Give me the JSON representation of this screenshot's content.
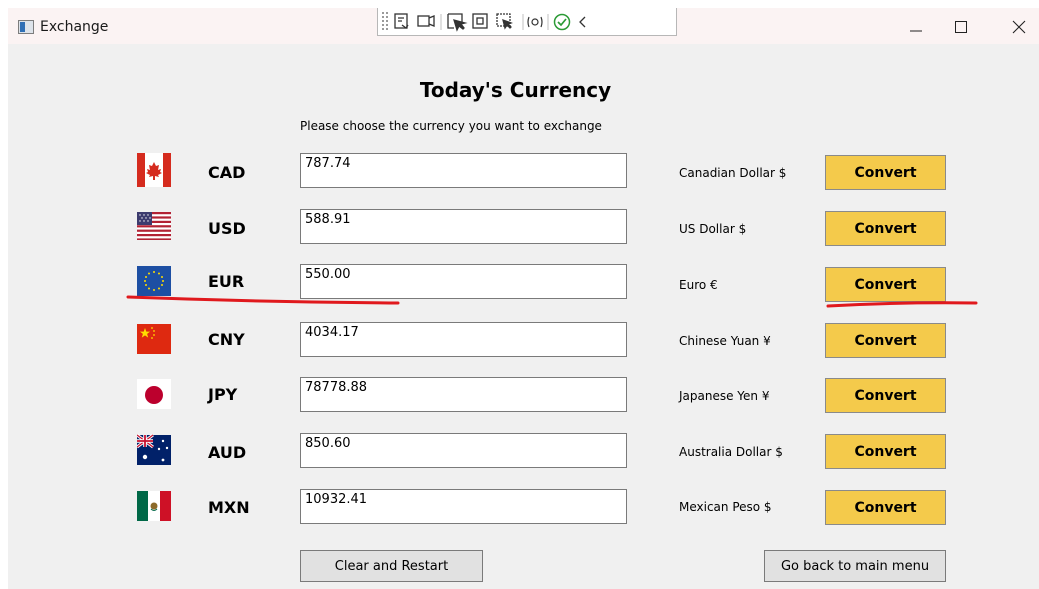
{
  "window": {
    "title": "Exchange"
  },
  "header": {
    "title": "Today's Currency",
    "instruction": "Please choose the currency you want to exchange"
  },
  "rows": [
    {
      "flag": "canada-flag-icon",
      "code": "CAD",
      "amount": "787.74",
      "name": "Canadian Dollar $",
      "button": "Convert"
    },
    {
      "flag": "usa-flag-icon",
      "code": "USD",
      "amount": "588.91",
      "name": "US Dollar $",
      "button": "Convert"
    },
    {
      "flag": "eu-flag-icon",
      "code": "EUR",
      "amount": "550.00",
      "name": "Euro €",
      "button": "Convert"
    },
    {
      "flag": "china-flag-icon",
      "code": "CNY",
      "amount": "4034.17",
      "name": "Chinese Yuan ¥",
      "button": "Convert"
    },
    {
      "flag": "japan-flag-icon",
      "code": "JPY",
      "amount": "78778.88",
      "name": "Japanese Yen ¥",
      "button": "Convert"
    },
    {
      "flag": "australia-flag-icon",
      "code": "AUD",
      "amount": "850.60",
      "name": "Australia Dollar $",
      "button": "Convert"
    },
    {
      "flag": "mexico-flag-icon",
      "code": "MXN",
      "amount": "10932.41",
      "name": "Mexican Peso $",
      "button": "Convert"
    }
  ],
  "footer": {
    "clear_label": "Clear and Restart",
    "back_label": "Go back to main menu"
  },
  "colors": {
    "convert_button": "#f4ca4b",
    "annotation_underline": "#e0191d"
  }
}
